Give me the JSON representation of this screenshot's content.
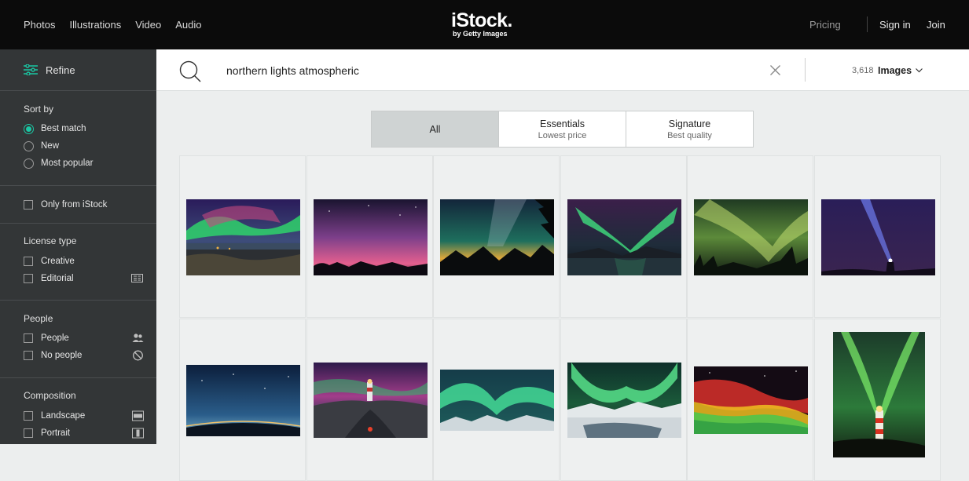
{
  "nav": {
    "links": [
      "Photos",
      "Illustrations",
      "Video",
      "Audio"
    ],
    "logo_main": "iStock.",
    "logo_sub": "by Getty Images",
    "pricing": "Pricing",
    "sign_in": "Sign in",
    "join": "Join"
  },
  "sidebar": {
    "refine": "Refine",
    "sort_by": {
      "title": "Sort by",
      "options": [
        "Best match",
        "New",
        "Most popular"
      ],
      "selected": "Best match"
    },
    "only_istock": "Only from iStock",
    "license": {
      "title": "License type",
      "options": [
        "Creative",
        "Editorial"
      ]
    },
    "people": {
      "title": "People",
      "options": [
        "People",
        "No people"
      ]
    },
    "composition": {
      "title": "Composition",
      "options": [
        "Landscape",
        "Portrait"
      ]
    }
  },
  "search": {
    "query": "northern lights atmospheric",
    "count": "3,618",
    "media_type": "Images"
  },
  "tabs": [
    {
      "label": "All",
      "sub": ""
    },
    {
      "label": "Essentials",
      "sub": "Lowest price"
    },
    {
      "label": "Signature",
      "sub": "Best quality"
    }
  ],
  "colors": {
    "accent": "#1bc7a4",
    "topbar": "#0b0b0b",
    "sidebar": "#333637"
  },
  "images": [
    {
      "desc": "aurora green purple over lake"
    },
    {
      "desc": "pink aurora starry sky"
    },
    {
      "desc": "milky way mountains yellow horizon"
    },
    {
      "desc": "green aurora swirl over lake"
    },
    {
      "desc": "green aurora cloudy sky"
    },
    {
      "desc": "person with flashlight beam"
    },
    {
      "desc": "blue starry sky wide angle"
    },
    {
      "desc": "lighthouse purple aurora"
    },
    {
      "desc": "green aurora over snowy mountains"
    },
    {
      "desc": "green aurora over frozen lake"
    },
    {
      "desc": "red green aurora"
    },
    {
      "desc": "lighthouse green aurora portrait"
    }
  ]
}
